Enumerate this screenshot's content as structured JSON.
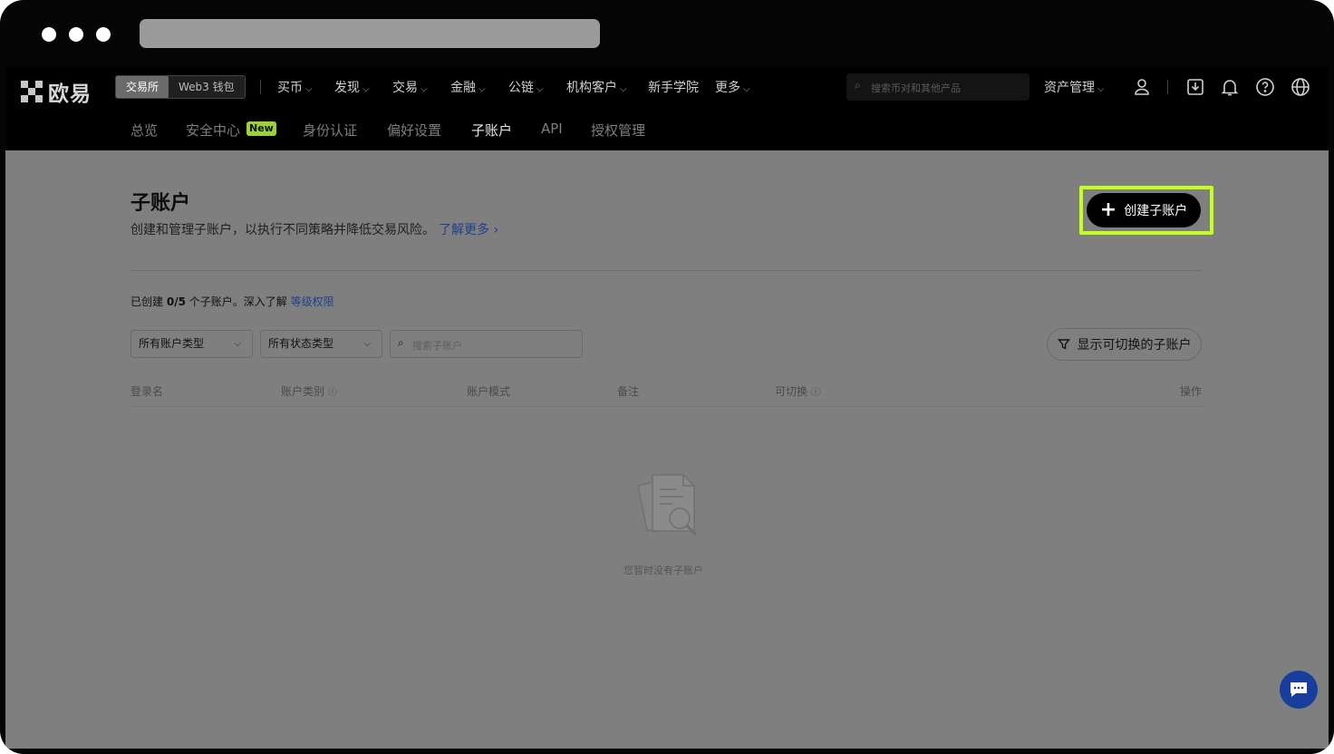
{
  "brand": {
    "logo_text": "欧易"
  },
  "header": {
    "mode_tabs": [
      {
        "label": "交易所",
        "active": true
      },
      {
        "label": "Web3 钱包",
        "active": false
      }
    ],
    "nav_items": [
      {
        "label": "买币",
        "has_dropdown": true
      },
      {
        "label": "发现",
        "has_dropdown": true
      },
      {
        "label": "交易",
        "has_dropdown": true
      },
      {
        "label": "金融",
        "has_dropdown": true
      },
      {
        "label": "公链",
        "has_dropdown": true
      },
      {
        "label": "机构客户",
        "has_dropdown": true
      },
      {
        "label": "新手学院",
        "has_dropdown": false
      },
      {
        "label": "更多",
        "has_dropdown": true
      }
    ],
    "search_placeholder": "搜索币对和其他产品",
    "assets_label": "资产管理",
    "icons": [
      "user-icon",
      "download-icon",
      "bell-icon",
      "help-icon",
      "globe-icon"
    ]
  },
  "subnav": {
    "items": [
      {
        "label": "总览"
      },
      {
        "label": "安全中心",
        "badge": "New"
      },
      {
        "label": "身份认证"
      },
      {
        "label": "偏好设置"
      },
      {
        "label": "子账户",
        "active": true
      },
      {
        "label": "API"
      },
      {
        "label": "授权管理"
      }
    ]
  },
  "page": {
    "title": "子账户",
    "description": "创建和管理子账户，以执行不同策略并降低交易风险。",
    "learn_more": "了解更多",
    "create_button": "创建子账户",
    "count_prefix": "已创建",
    "count_value": "0/5",
    "count_suffix": "个子账户。深入了解",
    "level_link": "等级权限",
    "filters": {
      "account_type": "所有账户类型",
      "status_type": "所有状态类型",
      "search_placeholder": "搜索子账户",
      "switchable_button": "显示可切换的子账户"
    },
    "table_headers": [
      "登录名",
      "账户类别",
      "账户模式",
      "备注",
      "可切换",
      "操作"
    ],
    "empty_text": "您暂时没有子账户"
  },
  "colors": {
    "highlight": "#c4ff1f",
    "badge": "#9ed03a",
    "link": "#1f3f8f",
    "chat_fab": "#173e9a"
  }
}
